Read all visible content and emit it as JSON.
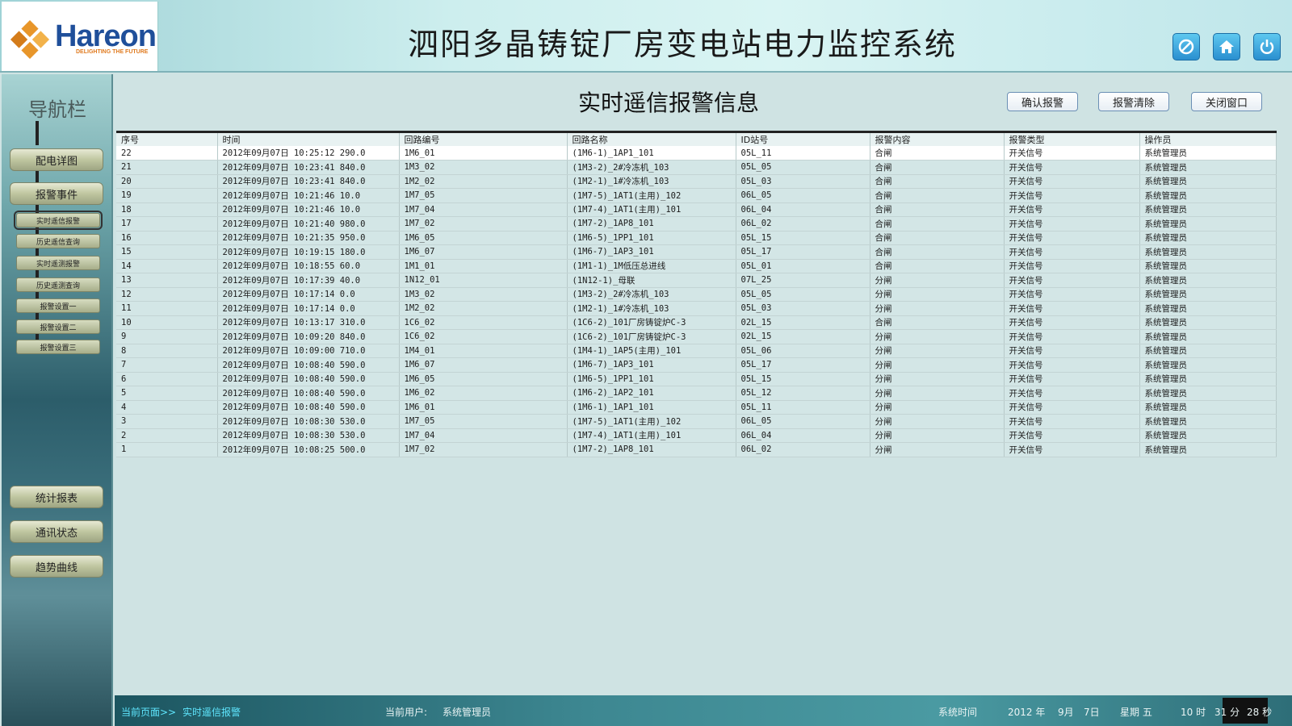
{
  "header": {
    "logo_text": "Hareon",
    "logo_tagline": "DELIGHTING THE FUTURE",
    "system_title": "泗阳多晶铸锭厂房变电站电力监控系统",
    "icons": [
      "forbidden-icon",
      "home-icon",
      "power-icon"
    ]
  },
  "sidebar": {
    "title": "导航栏",
    "primary_top": [
      "配电详图",
      "报警事件"
    ],
    "sub_items": [
      "实时遥信报警",
      "历史遥信查询",
      "实时遥测报警",
      "历史遥测查询",
      "报警设置一",
      "报警设置二",
      "报警设置三"
    ],
    "active_sub": "实时遥信报警",
    "primary_bottom": [
      "统计报表",
      "通讯状态",
      "趋势曲线"
    ]
  },
  "main": {
    "title": "实时遥信报警信息",
    "buttons": {
      "confirm": "确认报警",
      "clear": "报警清除",
      "close": "关闭窗口"
    },
    "table": {
      "columns": [
        "序号",
        "时间",
        "回路编号",
        "回路名称",
        "ID站号",
        "报警内容",
        "报警类型",
        "操作员"
      ],
      "rows": [
        [
          "22",
          "2012年09月07日 10:25:12 290.0",
          "1M6_01",
          "(1M6-1)_1AP1_101",
          "05L_11",
          "合闸",
          "开关信号",
          "系统管理员"
        ],
        [
          "21",
          "2012年09月07日 10:23:41 840.0",
          "1M3_02",
          "(1M3-2)_2#冷冻机_103",
          "05L_05",
          "合闸",
          "开关信号",
          "系统管理员"
        ],
        [
          "20",
          "2012年09月07日 10:23:41 840.0",
          "1M2_02",
          "(1M2-1)_1#冷冻机_103",
          "05L_03",
          "合闸",
          "开关信号",
          "系统管理员"
        ],
        [
          "19",
          "2012年09月07日 10:21:46  10.0",
          "1M7_05",
          "(1M7-5)_1AT1(主用)_102",
          "06L_05",
          "合闸",
          "开关信号",
          "系统管理员"
        ],
        [
          "18",
          "2012年09月07日 10:21:46  10.0",
          "1M7_04",
          "(1M7-4)_1AT1(主用)_101",
          "06L_04",
          "合闸",
          "开关信号",
          "系统管理员"
        ],
        [
          "17",
          "2012年09月07日 10:21:40 980.0",
          "1M7_02",
          "(1M7-2)_1AP8_101",
          "06L_02",
          "合闸",
          "开关信号",
          "系统管理员"
        ],
        [
          "16",
          "2012年09月07日 10:21:35 950.0",
          "1M6_05",
          "(1M6-5)_1PP1_101",
          "05L_15",
          "合闸",
          "开关信号",
          "系统管理员"
        ],
        [
          "15",
          "2012年09月07日 10:19:15 180.0",
          "1M6_07",
          "(1M6-7)_1AP3_101",
          "05L_17",
          "合闸",
          "开关信号",
          "系统管理员"
        ],
        [
          "14",
          "2012年09月07日 10:18:55  60.0",
          "1M1_01",
          "(1M1-1)_1M低压总进线",
          "05L_01",
          "合闸",
          "开关信号",
          "系统管理员"
        ],
        [
          "13",
          "2012年09月07日 10:17:39  40.0",
          "1N12_01",
          "(1N12-1)_母联",
          "07L_25",
          "分闸",
          "开关信号",
          "系统管理员"
        ],
        [
          "12",
          "2012年09月07日 10:17:14   0.0",
          "1M3_02",
          "(1M3-2)_2#冷冻机_103",
          "05L_05",
          "分闸",
          "开关信号",
          "系统管理员"
        ],
        [
          "11",
          "2012年09月07日 10:17:14   0.0",
          "1M2_02",
          "(1M2-1)_1#冷冻机_103",
          "05L_03",
          "分闸",
          "开关信号",
          "系统管理员"
        ],
        [
          "10",
          "2012年09月07日 10:13:17 310.0",
          "1C6_02",
          "(1C6-2)_101厂房铸锭炉C-3",
          "02L_15",
          "合闸",
          "开关信号",
          "系统管理员"
        ],
        [
          "9",
          "2012年09月07日 10:09:20 840.0",
          "1C6_02",
          "(1C6-2)_101厂房铸锭炉C-3",
          "02L_15",
          "分闸",
          "开关信号",
          "系统管理员"
        ],
        [
          "8",
          "2012年09月07日 10:09:00 710.0",
          "1M4_01",
          "(1M4-1)_1AP5(主用)_101",
          "05L_06",
          "分闸",
          "开关信号",
          "系统管理员"
        ],
        [
          "7",
          "2012年09月07日 10:08:40 590.0",
          "1M6_07",
          "(1M6-7)_1AP3_101",
          "05L_17",
          "分闸",
          "开关信号",
          "系统管理员"
        ],
        [
          "6",
          "2012年09月07日 10:08:40 590.0",
          "1M6_05",
          "(1M6-5)_1PP1_101",
          "05L_15",
          "分闸",
          "开关信号",
          "系统管理员"
        ],
        [
          "5",
          "2012年09月07日 10:08:40 590.0",
          "1M6_02",
          "(1M6-2)_1AP2_101",
          "05L_12",
          "分闸",
          "开关信号",
          "系统管理员"
        ],
        [
          "4",
          "2012年09月07日 10:08:40 590.0",
          "1M6_01",
          "(1M6-1)_1AP1_101",
          "05L_11",
          "分闸",
          "开关信号",
          "系统管理员"
        ],
        [
          "3",
          "2012年09月07日 10:08:30 530.0",
          "1M7_05",
          "(1M7-5)_1AT1(主用)_102",
          "06L_05",
          "分闸",
          "开关信号",
          "系统管理员"
        ],
        [
          "2",
          "2012年09月07日 10:08:30 530.0",
          "1M7_04",
          "(1M7-4)_1AT1(主用)_101",
          "06L_04",
          "分闸",
          "开关信号",
          "系统管理员"
        ],
        [
          "1",
          "2012年09月07日 10:08:25 500.0",
          "1M7_02",
          "(1M7-2)_1AP8_101",
          "06L_02",
          "分闸",
          "开关信号",
          "系统管理员"
        ]
      ]
    }
  },
  "statusbar": {
    "current_page_label": "当前页面>>",
    "current_page": "实时遥信报警",
    "user_label": "当前用户:",
    "user": "系统管理员",
    "time_label": "系统时间",
    "year": "2012 年",
    "month": "9月",
    "day": "7日",
    "weekday": "星期 五",
    "hour": "10 时",
    "minute": "31 分",
    "second": "28 秒"
  }
}
